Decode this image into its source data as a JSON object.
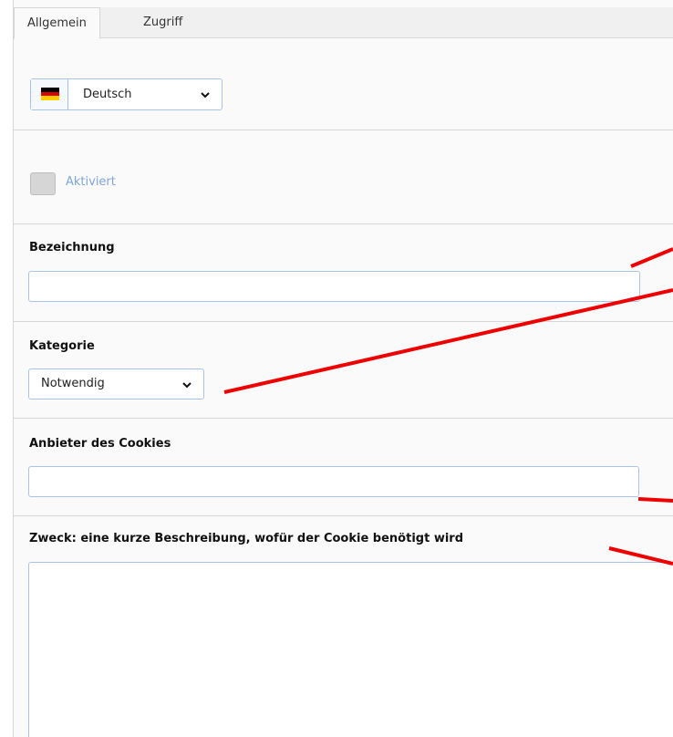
{
  "tabs": [
    {
      "label": "Allgemein",
      "active": true
    },
    {
      "label": "Zugriff",
      "active": false
    }
  ],
  "language_select": {
    "value": "Deutsch",
    "flag": "de-flag-icon"
  },
  "activated": {
    "label": "Aktiviert",
    "checked": false
  },
  "fields": {
    "bezeichnung": {
      "label": "Bezeichnung",
      "value": ""
    },
    "kategorie": {
      "label": "Kategorie",
      "value": "Notwendig"
    },
    "anbieter": {
      "label": "Anbieter des Cookies",
      "value": ""
    },
    "zweck": {
      "label": "Zweck: eine kurze Beschreibung, wofür der Cookie benötigt wird",
      "value": ""
    }
  },
  "colors": {
    "input_border": "#a8c4e6",
    "annotation_line": "#ee0000",
    "link_label": "#7ea6d6",
    "flag": [
      "#000000",
      "#dd0000",
      "#ffce00"
    ]
  }
}
